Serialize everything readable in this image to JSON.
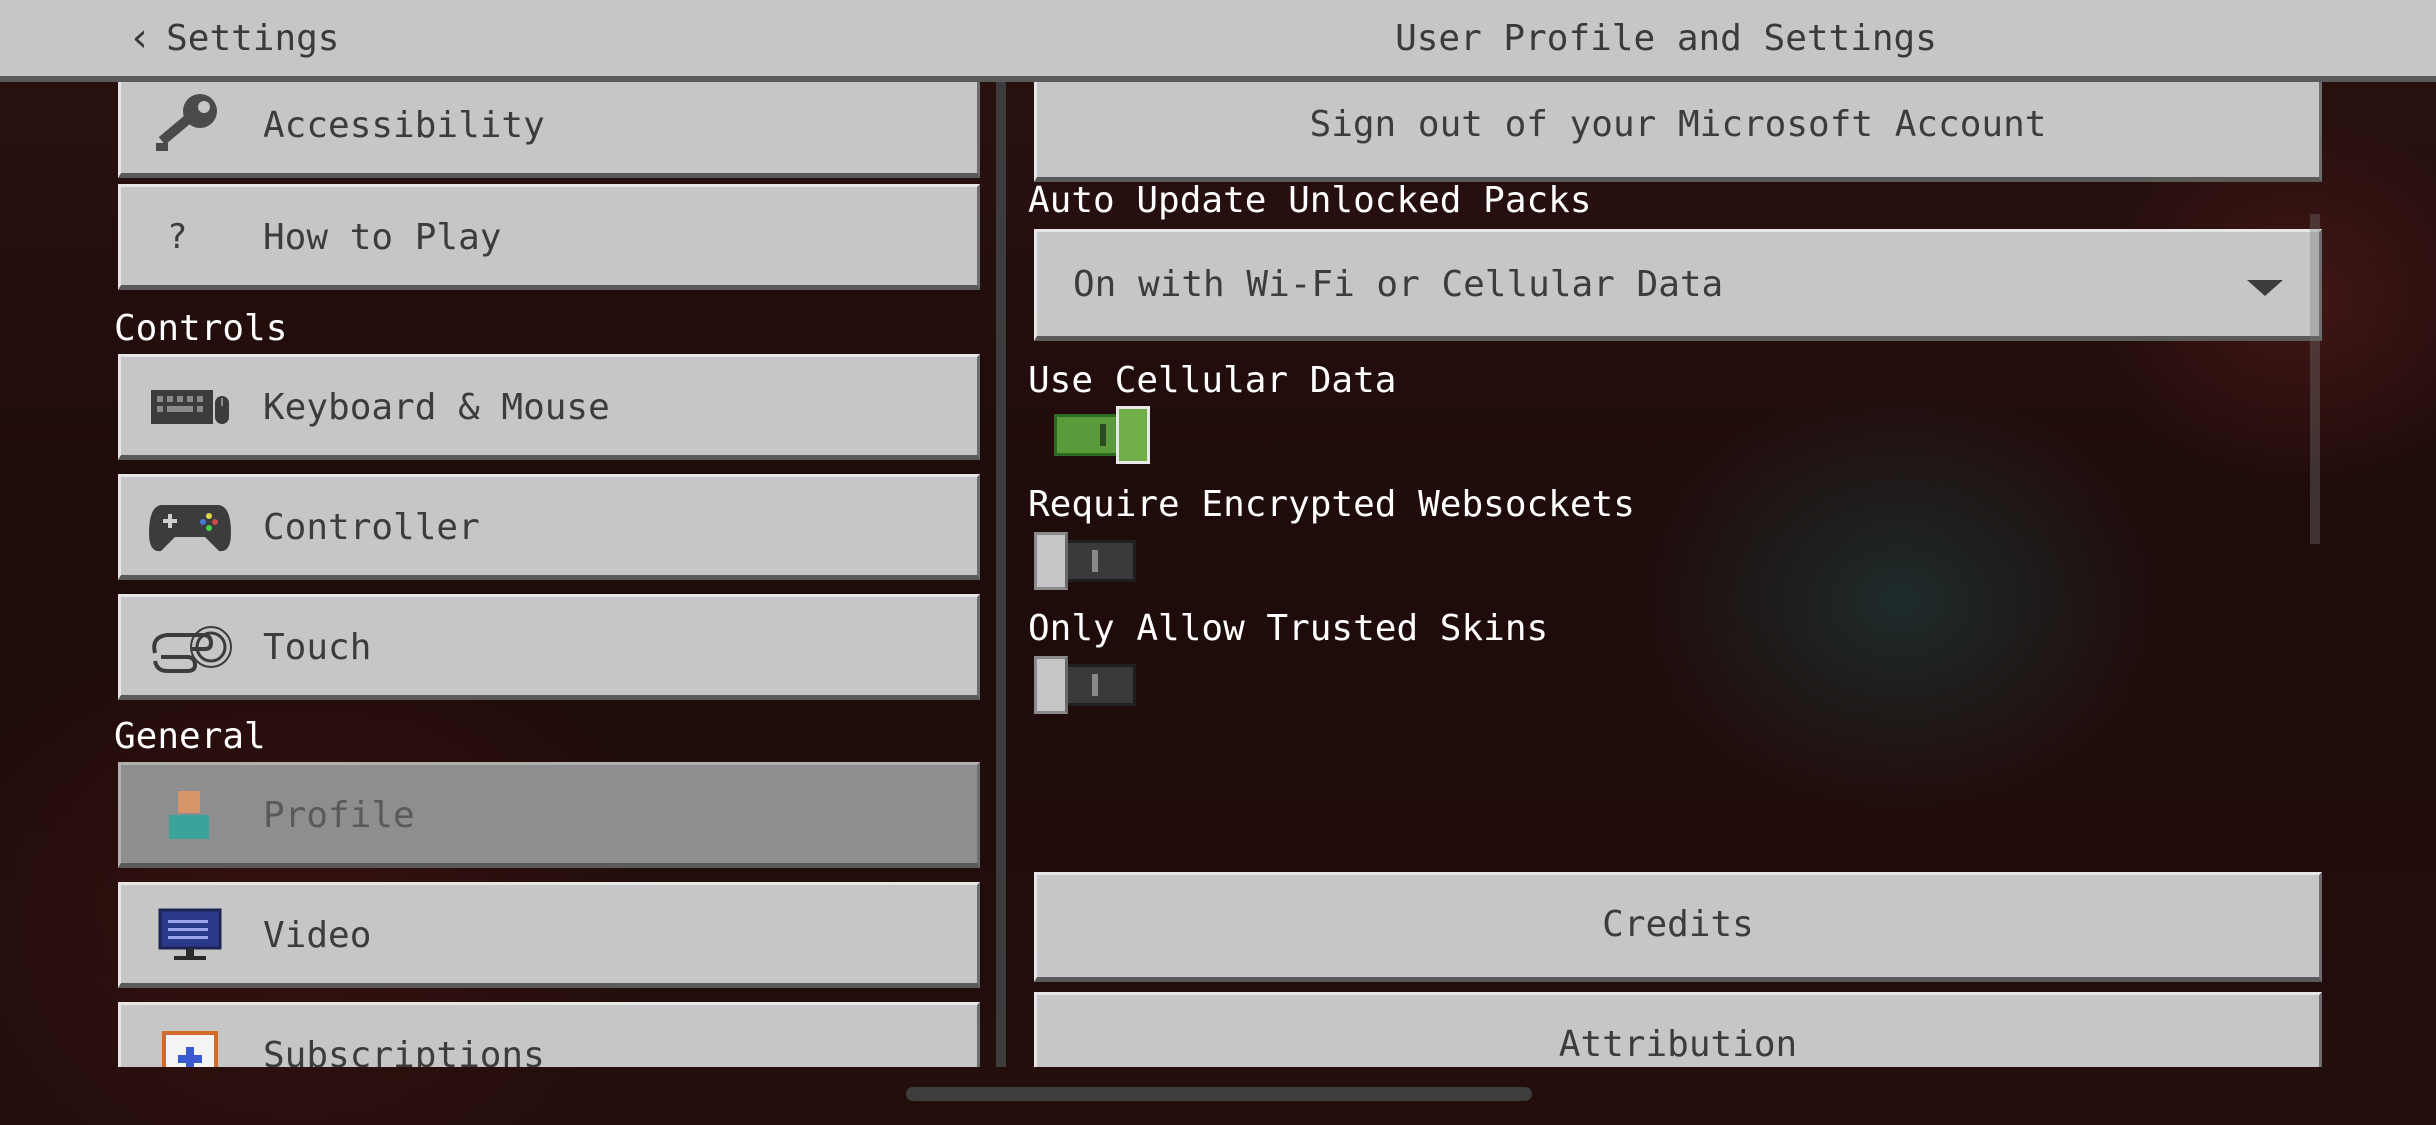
{
  "header": {
    "back_label": "Settings",
    "title": "User Profile and Settings"
  },
  "sidebar": {
    "sections": {
      "controls": "Controls",
      "general": "General"
    },
    "items": [
      {
        "label": "Accessibility",
        "icon": "key-icon"
      },
      {
        "label": "How to Play",
        "icon": "question-icon",
        "glyph": "?"
      },
      {
        "label": "Keyboard & Mouse",
        "icon": "keyboard-icon"
      },
      {
        "label": "Controller",
        "icon": "gamepad-icon"
      },
      {
        "label": "Touch",
        "icon": "touch-hand-icon"
      },
      {
        "label": "Profile",
        "icon": "profile-icon",
        "selected": true
      },
      {
        "label": "Video",
        "icon": "monitor-icon"
      },
      {
        "label": "Subscriptions",
        "icon": "calendar-icon"
      }
    ]
  },
  "main": {
    "sign_out_label": "Sign out of your Microsoft Account",
    "auto_update": {
      "label": "Auto Update Unlocked Packs",
      "value": "On with Wi-Fi or Cellular Data"
    },
    "toggles": [
      {
        "label": "Use Cellular Data",
        "on": true
      },
      {
        "label": "Require Encrypted Websockets",
        "on": false
      },
      {
        "label": "Only Allow Trusted Skins",
        "on": false
      }
    ],
    "credits_label": "Credits",
    "attribution_label": "Attribution"
  },
  "colors": {
    "panel": "#c6c6c6",
    "selected": "#8e8e8e",
    "toggle_on": "#5a9a3a",
    "toggle_off": "#3a3a3a"
  }
}
